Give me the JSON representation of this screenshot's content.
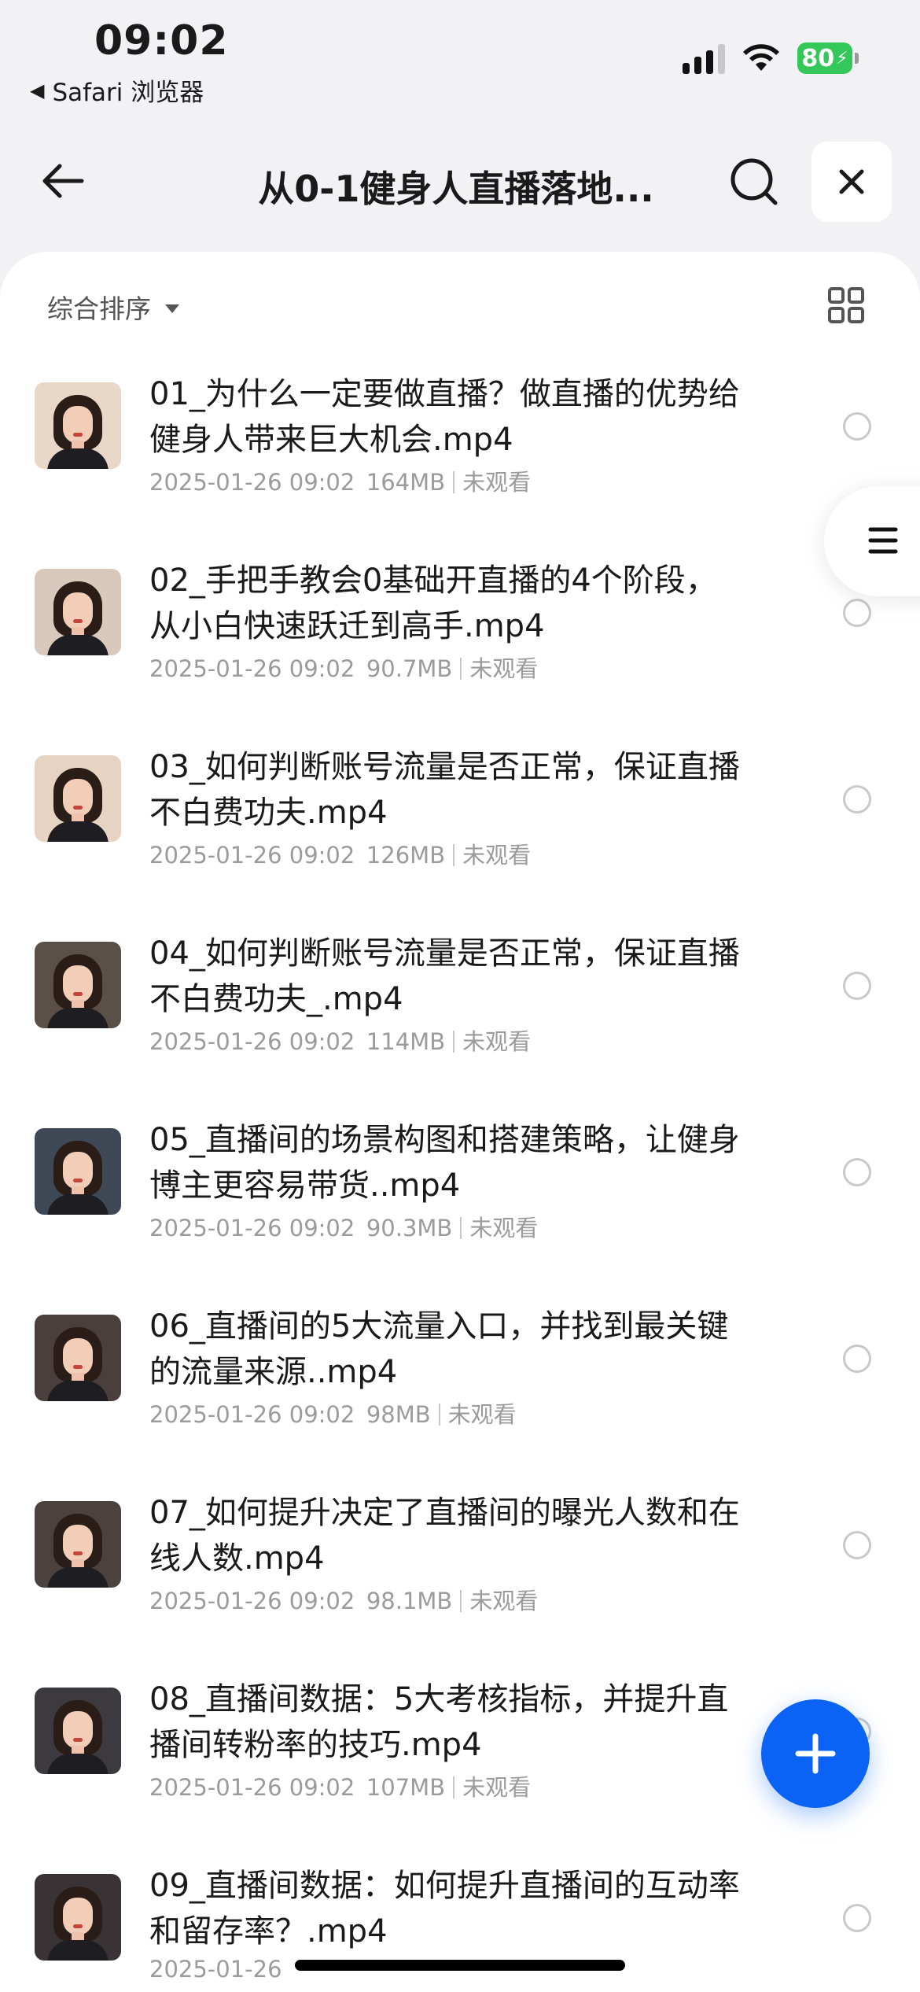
{
  "status_bar": {
    "time": "09:02",
    "back_app_label": "Safari 浏览器",
    "battery_percent": "80"
  },
  "header": {
    "title": "从0-1健身人直播落地...",
    "back_icon": "arrow-left-icon",
    "search_icon": "search-icon",
    "close_icon": "close-icon"
  },
  "toolbar": {
    "sort_label": "综合排序",
    "view_toggle_icon": "grid-view-icon"
  },
  "files": [
    {
      "name": "01_为什么一定要做直播？做直播的优势给健身人带来巨大机会.mp4",
      "date": "2025-01-26 09:02",
      "size": "164MB",
      "status": "未观看"
    },
    {
      "name": "02_手把手教会0基础开直播的4个阶段，从小白快速跃迁到高手.mp4",
      "date": "2025-01-26 09:02",
      "size": "90.7MB",
      "status": "未观看"
    },
    {
      "name": "03_如何判断账号流量是否正常，保证直播不白费功夫.mp4",
      "date": "2025-01-26 09:02",
      "size": "126MB",
      "status": "未观看"
    },
    {
      "name": "04_如何判断账号流量是否正常，保证直播不白费功夫_.mp4",
      "date": "2025-01-26 09:02",
      "size": "114MB",
      "status": "未观看"
    },
    {
      "name": "05_直播间的场景构图和搭建策略，让健身博主更容易带货..mp4",
      "date": "2025-01-26 09:02",
      "size": "90.3MB",
      "status": "未观看"
    },
    {
      "name": "06_直播间的5大流量入口，并找到最关键的流量来源..mp4",
      "date": "2025-01-26 09:02",
      "size": "98MB",
      "status": "未观看"
    },
    {
      "name": "07_如何提升决定了直播间的曝光人数和在线人数.mp4",
      "date": "2025-01-26 09:02",
      "size": "98.1MB",
      "status": "未观看"
    },
    {
      "name": "08_直播间数据：5大考核指标，并提升直播间转粉率的技巧.mp4",
      "date": "2025-01-26 09:02",
      "size": "107MB",
      "status": "未观看"
    },
    {
      "name": "09_直播间数据：如何提升直播间的互动率和留存率？.mp4",
      "date": "2025-01-26",
      "size": "",
      "status": ""
    }
  ],
  "floating": {
    "side_menu_icon": "menu-icon",
    "add_icon": "plus-icon"
  },
  "colors": {
    "accent": "#0a63f4",
    "battery_green": "#34c759",
    "background": "#f2f2f4",
    "meta_text": "#9b9b9b"
  }
}
